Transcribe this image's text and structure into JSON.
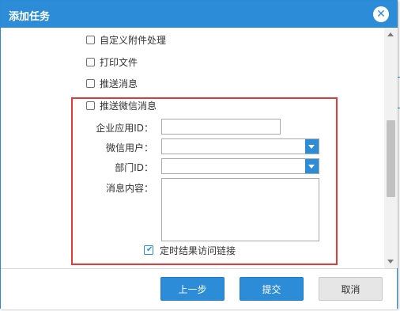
{
  "dialog": {
    "title": "添加任务",
    "close_icon": "close-icon"
  },
  "options": {
    "custom_attachment": "自定义附件处理",
    "print_file": "打印文件",
    "push_message": "推送消息",
    "push_wechat": "推送微信消息"
  },
  "wechat": {
    "corp_app_id_label": "企业应用ID：",
    "wechat_user_label": "微信用户：",
    "dept_id_label": "部门ID：",
    "message_content_label": "消息内容：",
    "timed_result_link_label": "定时结果访问链接",
    "timed_result_link_checked": true
  },
  "footer": {
    "prev_label": "上一步",
    "submit_label": "提交",
    "cancel_label": "取消"
  },
  "colors": {
    "accent": "#2d8cd7",
    "highlight": "#e23a3a"
  }
}
